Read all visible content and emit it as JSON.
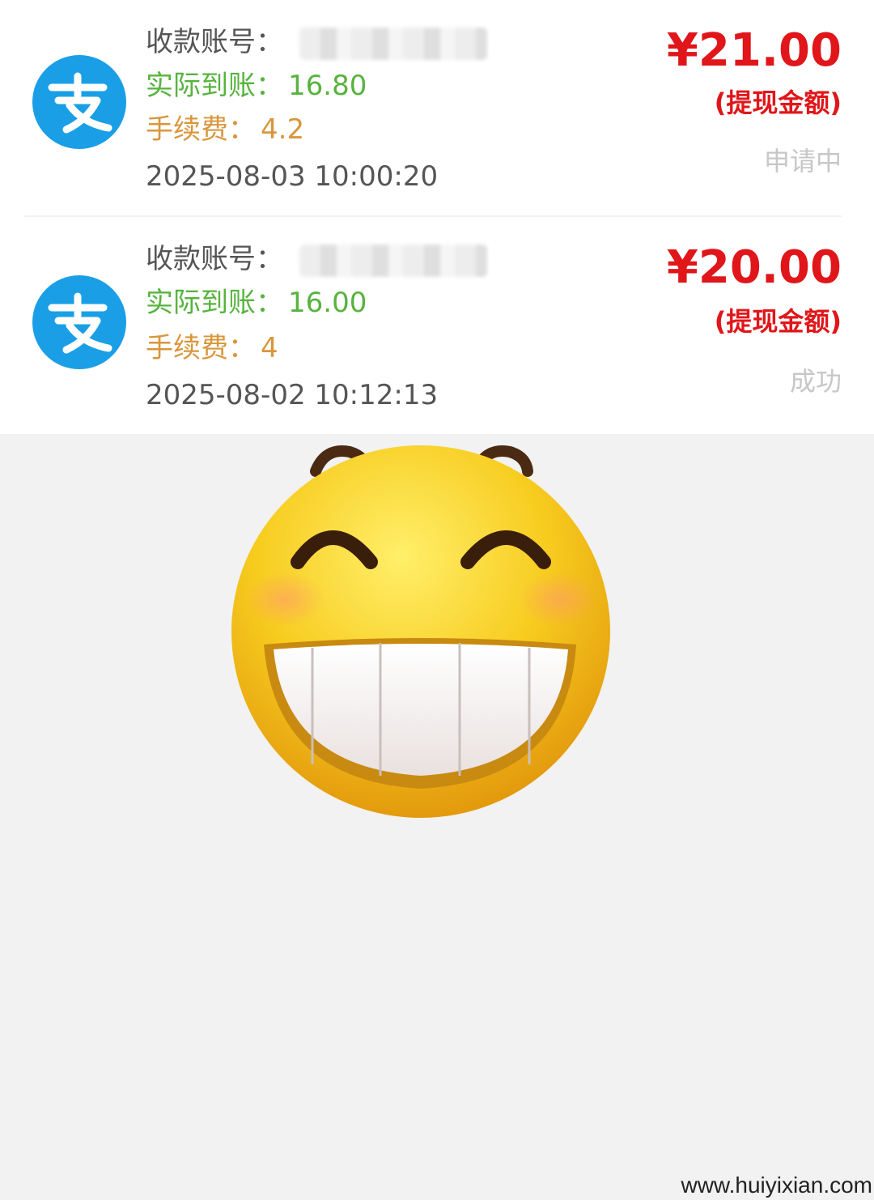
{
  "records": [
    {
      "account_label": "收款账号：",
      "actual_label": "实际到账：",
      "actual_value": "16.80",
      "fee_label": "手续费：",
      "fee_value": "4.2",
      "time": "2025-08-03 10:00:20",
      "amount": "¥21.00",
      "amount_label": "(提现金额)",
      "status": "申请中",
      "icon": "alipay-icon"
    },
    {
      "account_label": "收款账号：",
      "actual_label": "实际到账：",
      "actual_value": "16.00",
      "fee_label": "手续费：",
      "fee_value": "4",
      "time": "2025-08-02 10:12:13",
      "amount": "¥20.00",
      "amount_label": "(提现金额)",
      "status": "成功",
      "icon": "alipay-icon"
    }
  ],
  "watermark": "www.huiyixian.com",
  "colors": {
    "amount": "#e0161a",
    "actual": "#57b33e",
    "fee": "#d9963c",
    "status": "#c7c7c7",
    "alipay": "#1a9fe6"
  }
}
